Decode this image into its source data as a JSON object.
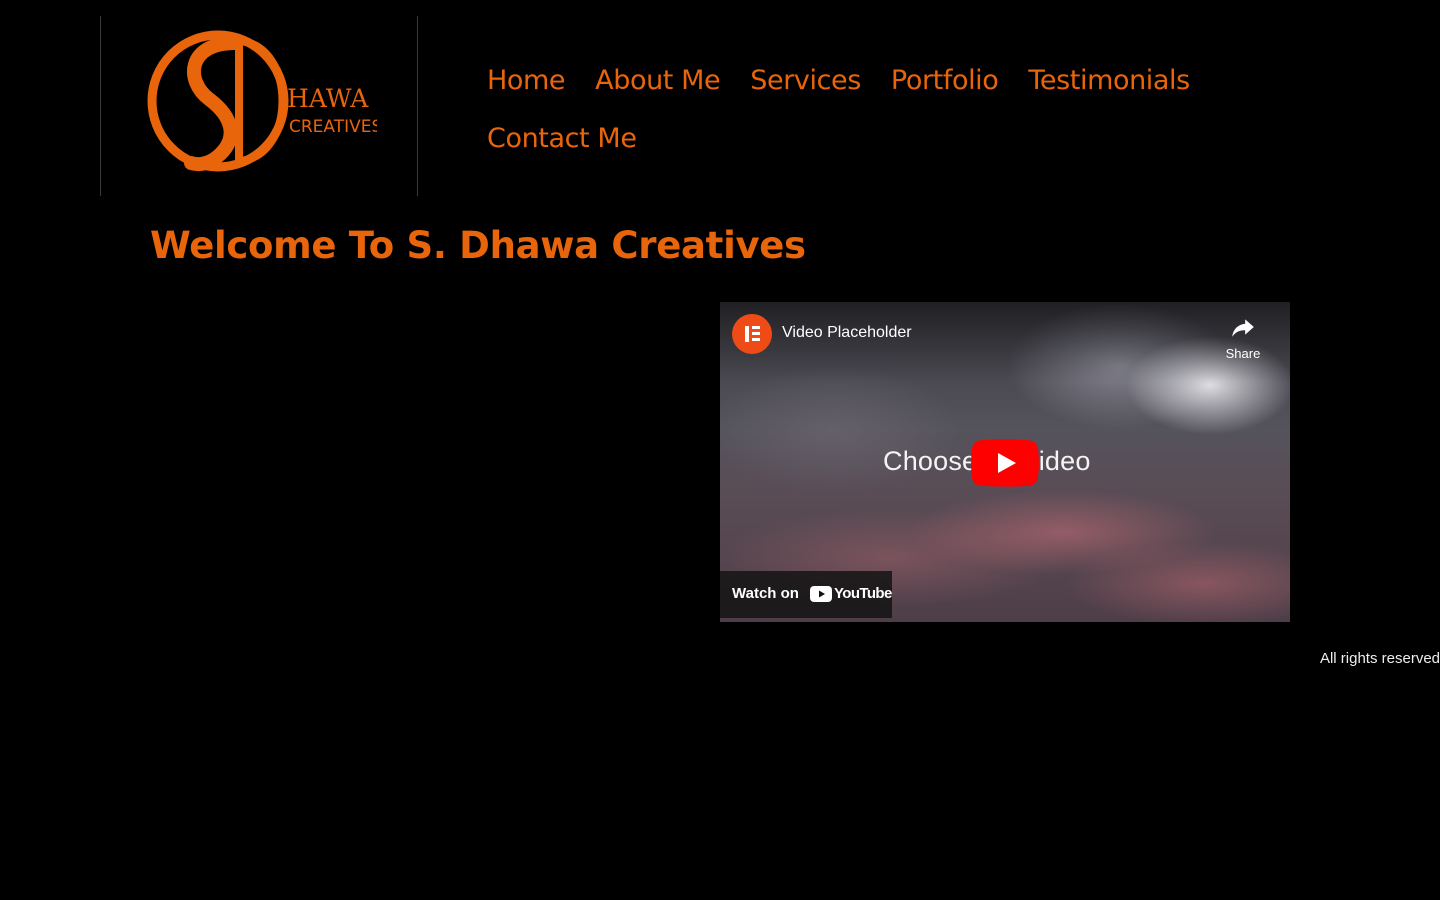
{
  "brand": {
    "logo_initials": "SD",
    "logo_line1": "HAWA",
    "logo_line2": "CREATIVES",
    "accent_color": "#e8650c"
  },
  "nav": {
    "items": [
      {
        "label": "Home"
      },
      {
        "label": "About Me"
      },
      {
        "label": "Services"
      },
      {
        "label": "Portfolio"
      },
      {
        "label": "Testimonials"
      },
      {
        "label": "Contact Me"
      }
    ]
  },
  "main": {
    "title": "Welcome To S. Dhawa Creatives"
  },
  "video": {
    "title": "Video Placeholder",
    "share_label": "Share",
    "overlay_left": "Choose",
    "overlay_bold": "r",
    "overlay_right": "video",
    "watch_label": "Watch on",
    "youtube_label": "YouTube",
    "channel_icon": "elementor-icon",
    "play_icon": "youtube-play-icon",
    "share_icon": "share-arrow-icon"
  },
  "footer": {
    "text": "All rights reserved"
  }
}
